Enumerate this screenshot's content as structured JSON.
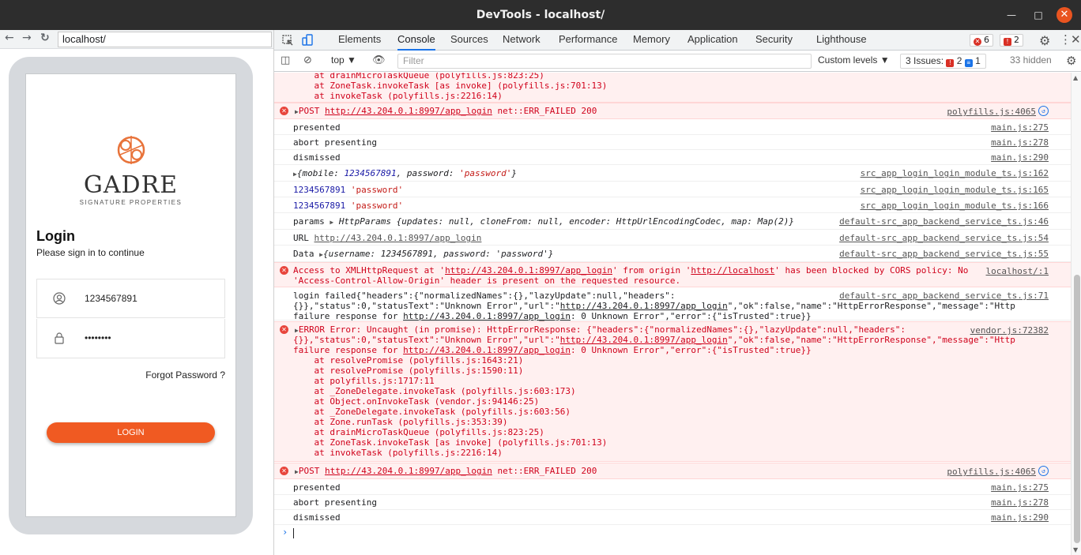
{
  "window": {
    "title": "DevTools - localhost/"
  },
  "device": {
    "address": "localhost/",
    "logo_text": "GADRE",
    "logo_sub": "SIGNATURE PROPERTIES",
    "login_title": "Login",
    "login_subtitle": "Please sign in to continue",
    "username_value": "1234567891",
    "password_value": "••••••••",
    "forgot_label": "Forgot Password ?",
    "login_button": "LOGIN",
    "accent_color": "#f05a22"
  },
  "devtools": {
    "tabs": [
      "Elements",
      "Console",
      "Sources",
      "Network",
      "Performance",
      "Memory",
      "Application",
      "Security",
      "Lighthouse"
    ],
    "active_tab": "Console",
    "error_count": "6",
    "issue_badge_count": "2",
    "context": "top ▼",
    "filter_placeholder": "Filter",
    "levels": "Custom levels ▼",
    "issues_label": "3 Issues:",
    "issues_errors": "2",
    "issues_info": "1",
    "hidden_label": "33 hidden"
  },
  "console": {
    "r1_l1": "    at drainMicroTaskQueue (polyfills.js:823:25)",
    "r1_l2": "    at ZoneTask.invokeTask [as invoke] (polyfills.js:701:13)",
    "r1_l3": "    at invokeTask (polyfills.js:2216:14)",
    "post1_method": "POST ",
    "post_url": "http://43.204.0.1:8997/app_login",
    "post1_tail": " net::ERR_FAILED 200",
    "post1_src": "polyfills.js:4065",
    "m_presented": "presented",
    "m_presented_src": "main.js:275",
    "m_abort": "abort presenting",
    "m_abort_src": "main.js:278",
    "m_dismissed": "dismissed",
    "m_dismissed_src": "main.js:290",
    "obj_mobile_key": "mobile: ",
    "obj_mobile_val": "1234567891",
    "obj_pw_key": ", password: ",
    "obj_pw_val": "'password'",
    "obj_src": "src_app_login_login_module_ts.js:162",
    "pair_num": "1234567891",
    "pair_str": "'password'",
    "pair1_src": "src_app_login_login_module_ts.js:165",
    "pair2_src": "src_app_login_login_module_ts.js:166",
    "params_label": "params ",
    "params_obj": "HttpParams {updates: null, cloneFrom: null, encoder: HttpUrlEncodingCodec, map: Map(2)}",
    "params_src": "default-src_app_backend_service_ts.js:46",
    "url_label": "URL ",
    "url_src": "default-src_app_backend_service_ts.js:54",
    "data_label": "Data ",
    "data_obj": "{username: 1234567891, password: 'password'}",
    "data_src": "default-src_app_backend_service_ts.js:55",
    "cors_1a": "Access to XMLHttpRequest at '",
    "cors_1b": "' from origin '",
    "cors_origin": "http://localhost",
    "cors_1c": "' has been blocked by CORS policy: No",
    "cors_2": "'Access-Control-Allow-Origin' header is present on the requested resource.",
    "cors_src": "localhost/:1",
    "lf_1": "login failed{\"headers\":{\"normalizedNames\":{},\"lazyUpdate\":null,\"headers\":",
    "lf_2a": "{}},\"status\":0,\"statusText\":\"Unknown Error\",\"url\":\"",
    "lf_2b": "\",\"ok\":false,\"name\":\"HttpErrorResponse\",\"message\":\"Http",
    "lf_3a": "failure response for ",
    "lf_3b": ": 0 Unknown Error\",\"error\":{\"isTrusted\":true}}",
    "lf_src": "default-src_app_backend_service_ts.js:71",
    "er_1": "ERROR Error: Uncaught (in promise): HttpErrorResponse: {\"headers\":{\"normalizedNames\":{},\"lazyUpdate\":null,\"headers\":",
    "er_2a": "{}},\"status\":0,\"statusText\":\"Unknown Error\",\"url\":\"",
    "er_2b": "\",\"ok\":false,\"name\":\"HttpErrorResponse\",\"message\":\"Http",
    "er_3a": "failure response for ",
    "er_3b": ": 0 Unknown Error\",\"error\":{\"isTrusted\":true}}",
    "er_src": "vendor.js:72382",
    "st_1": "    at resolvePromise (polyfills.js:1643:21)",
    "st_2": "    at resolvePromise (polyfills.js:1590:11)",
    "st_3": "    at polyfills.js:1717:11",
    "st_4": "    at _ZoneDelegate.invokeTask (polyfills.js:603:173)",
    "st_5": "    at Object.onInvokeTask (vendor.js:94146:25)",
    "st_6": "    at _ZoneDelegate.invokeTask (polyfills.js:603:56)",
    "st_7": "    at Zone.runTask (polyfills.js:353:39)",
    "st_8": "    at drainMicroTaskQueue (polyfills.js:823:25)",
    "st_9": "    at ZoneTask.invokeTask [as invoke] (polyfills.js:701:13)",
    "st_10": "    at invokeTask (polyfills.js:2216:14)"
  }
}
